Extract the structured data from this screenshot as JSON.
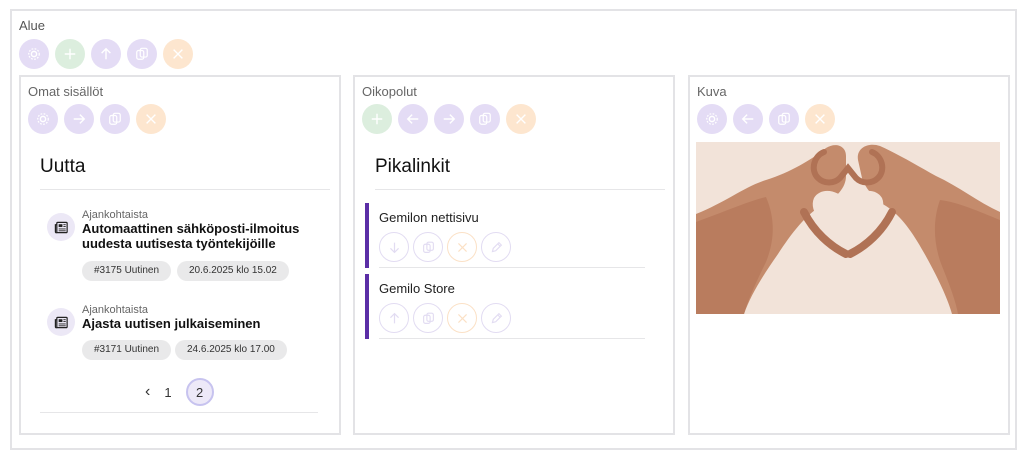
{
  "area": {
    "label": "Alue",
    "toolbar": [
      {
        "icon": "gear-icon",
        "color": "#e4dcf5"
      },
      {
        "icon": "plus-icon",
        "color": "#dceede"
      },
      {
        "icon": "arrow-up-icon",
        "color": "#e4dcf5"
      },
      {
        "icon": "copy-icon",
        "color": "#e4dcf5"
      },
      {
        "icon": "close-icon",
        "color": "#fde6cf"
      }
    ]
  },
  "own_content": {
    "label": "Omat sisällöt",
    "heading": "Uutta",
    "items": [
      {
        "category": "Ajankohtaista",
        "title": "Automaattinen sähköposti-ilmoitus uudesta uutisesta työntekijöille",
        "tag": "#3175 Uutinen",
        "date": "20.6.2025 klo 15.02"
      },
      {
        "category": "Ajankohtaista",
        "title": "Ajasta uutisen julkaiseminen",
        "tag": "#3171 Uutinen",
        "date": "24.6.2025 klo 17.00"
      }
    ],
    "pagination": {
      "prev": "‹",
      "pages": [
        "1",
        "2"
      ],
      "current": "2"
    }
  },
  "shortcuts": {
    "label": "Oikopolut",
    "heading": "Pikalinkit",
    "links": [
      {
        "title": "Gemilon nettisivu"
      },
      {
        "title": "Gemilo Store"
      }
    ],
    "accent": "#5b2ea6"
  },
  "image_panel": {
    "label": "Kuva",
    "image": "heart-hands-illustration"
  },
  "colors": {
    "purple_btn": "#e4dcf5",
    "green_btn": "#dceede",
    "orange_btn": "#fde6cf",
    "border": "#e3e3e6"
  }
}
